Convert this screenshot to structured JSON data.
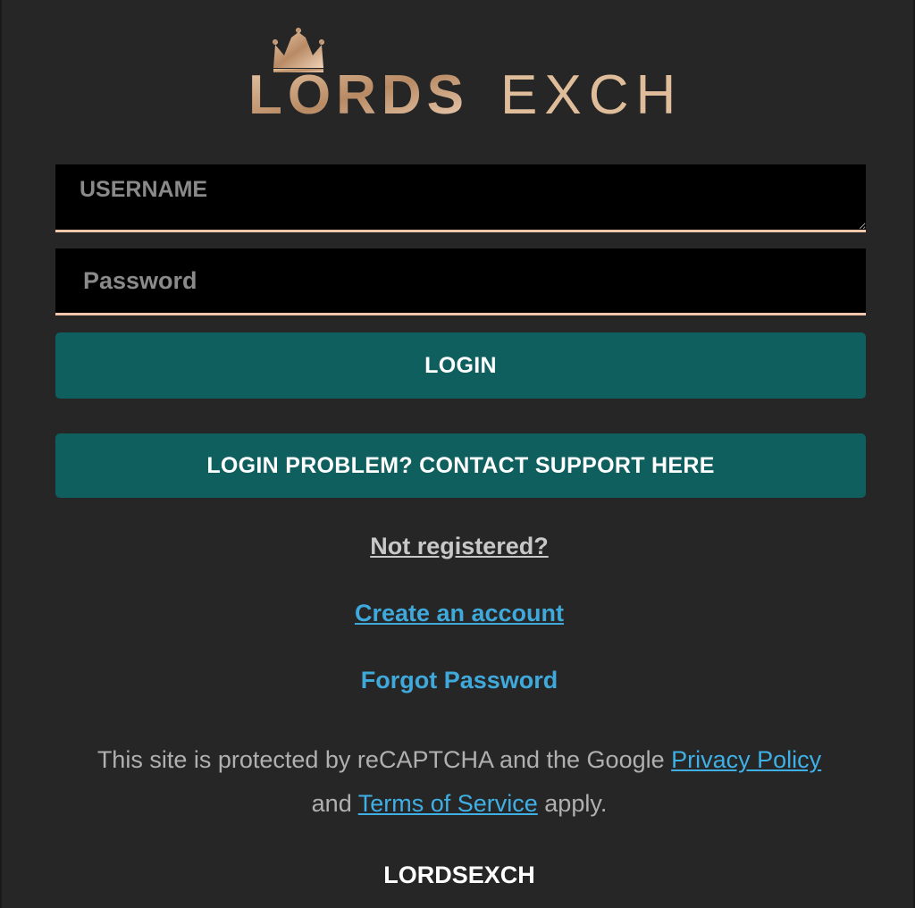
{
  "logo": {
    "word1": "LORDS",
    "word2": "EXCH",
    "icon": "crown-icon"
  },
  "form": {
    "username_placeholder": "USERNAME",
    "username_value": "",
    "password_placeholder": "Password",
    "password_value": "",
    "login_label": "LOGIN",
    "support_label": "LOGIN PROBLEM? CONTACT SUPPORT HERE"
  },
  "links": {
    "not_registered": "Not registered?",
    "create_account": "Create an account",
    "forgot_password": "Forgot Password"
  },
  "recaptcha": {
    "text_before": "This site is protected by reCAPTCHA and the Google ",
    "privacy_link": "Privacy Policy",
    "text_and": "and ",
    "terms_link": "Terms of Service",
    "text_after": " apply."
  },
  "footer": {
    "brand": "LORDSEXCH"
  },
  "colors": {
    "background": "#262626",
    "field_bg": "#000000",
    "field_underline": "#f3c7ab",
    "button_bg": "#0f5f5f",
    "link": "#3fa9db",
    "logo_gold": "#c9a27e"
  }
}
